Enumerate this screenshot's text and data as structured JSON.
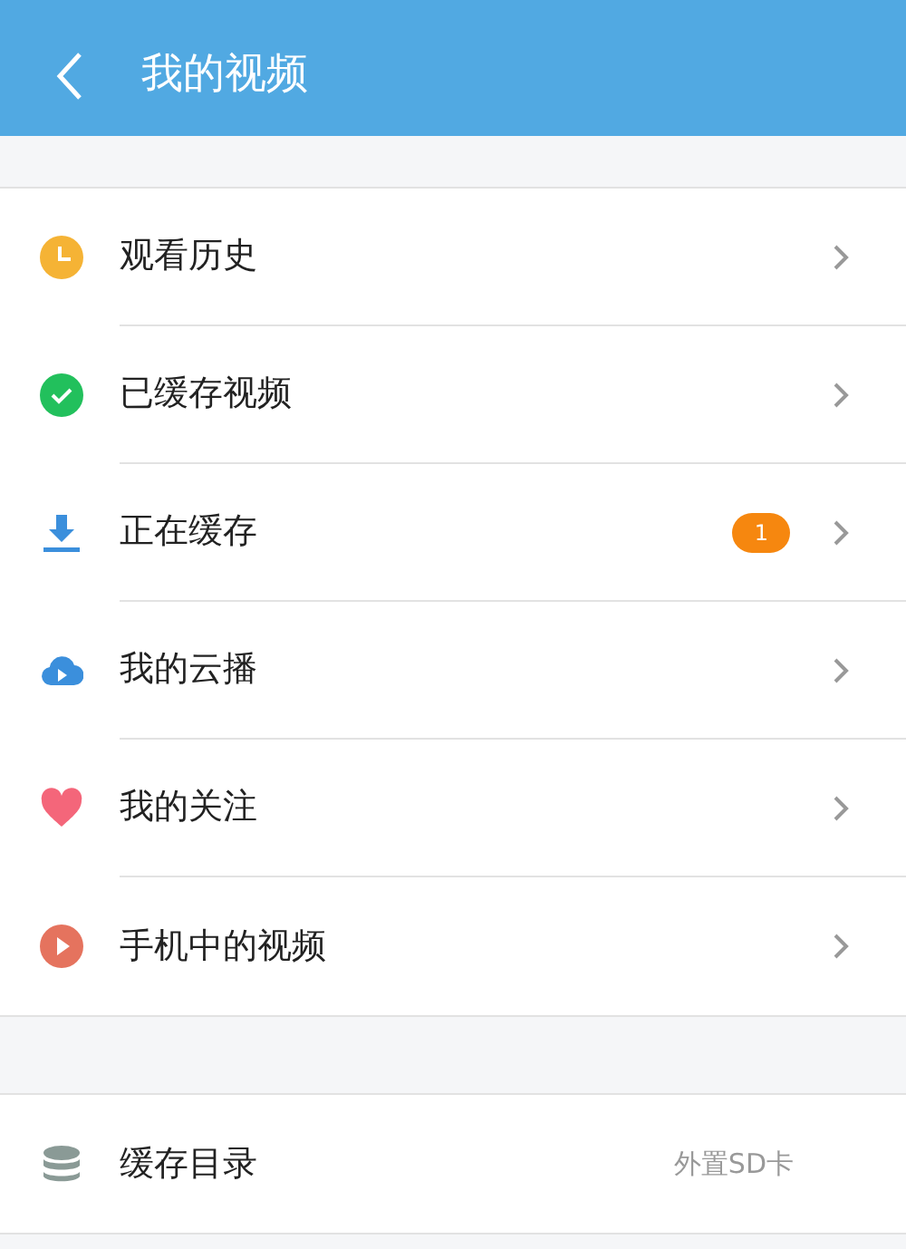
{
  "header": {
    "title": "我的视频"
  },
  "menu": [
    {
      "kind": "clock",
      "label": "观看历史"
    },
    {
      "kind": "check",
      "label": "已缓存视频"
    },
    {
      "kind": "download",
      "label": "正在缓存",
      "badge": "1"
    },
    {
      "kind": "cloud",
      "label": "我的云播"
    },
    {
      "kind": "heart",
      "label": "我的关注"
    },
    {
      "kind": "play",
      "label": "手机中的视频"
    }
  ],
  "settings": [
    {
      "kind": "storage",
      "label": "缓存目录",
      "value": "外置SD卡"
    }
  ]
}
